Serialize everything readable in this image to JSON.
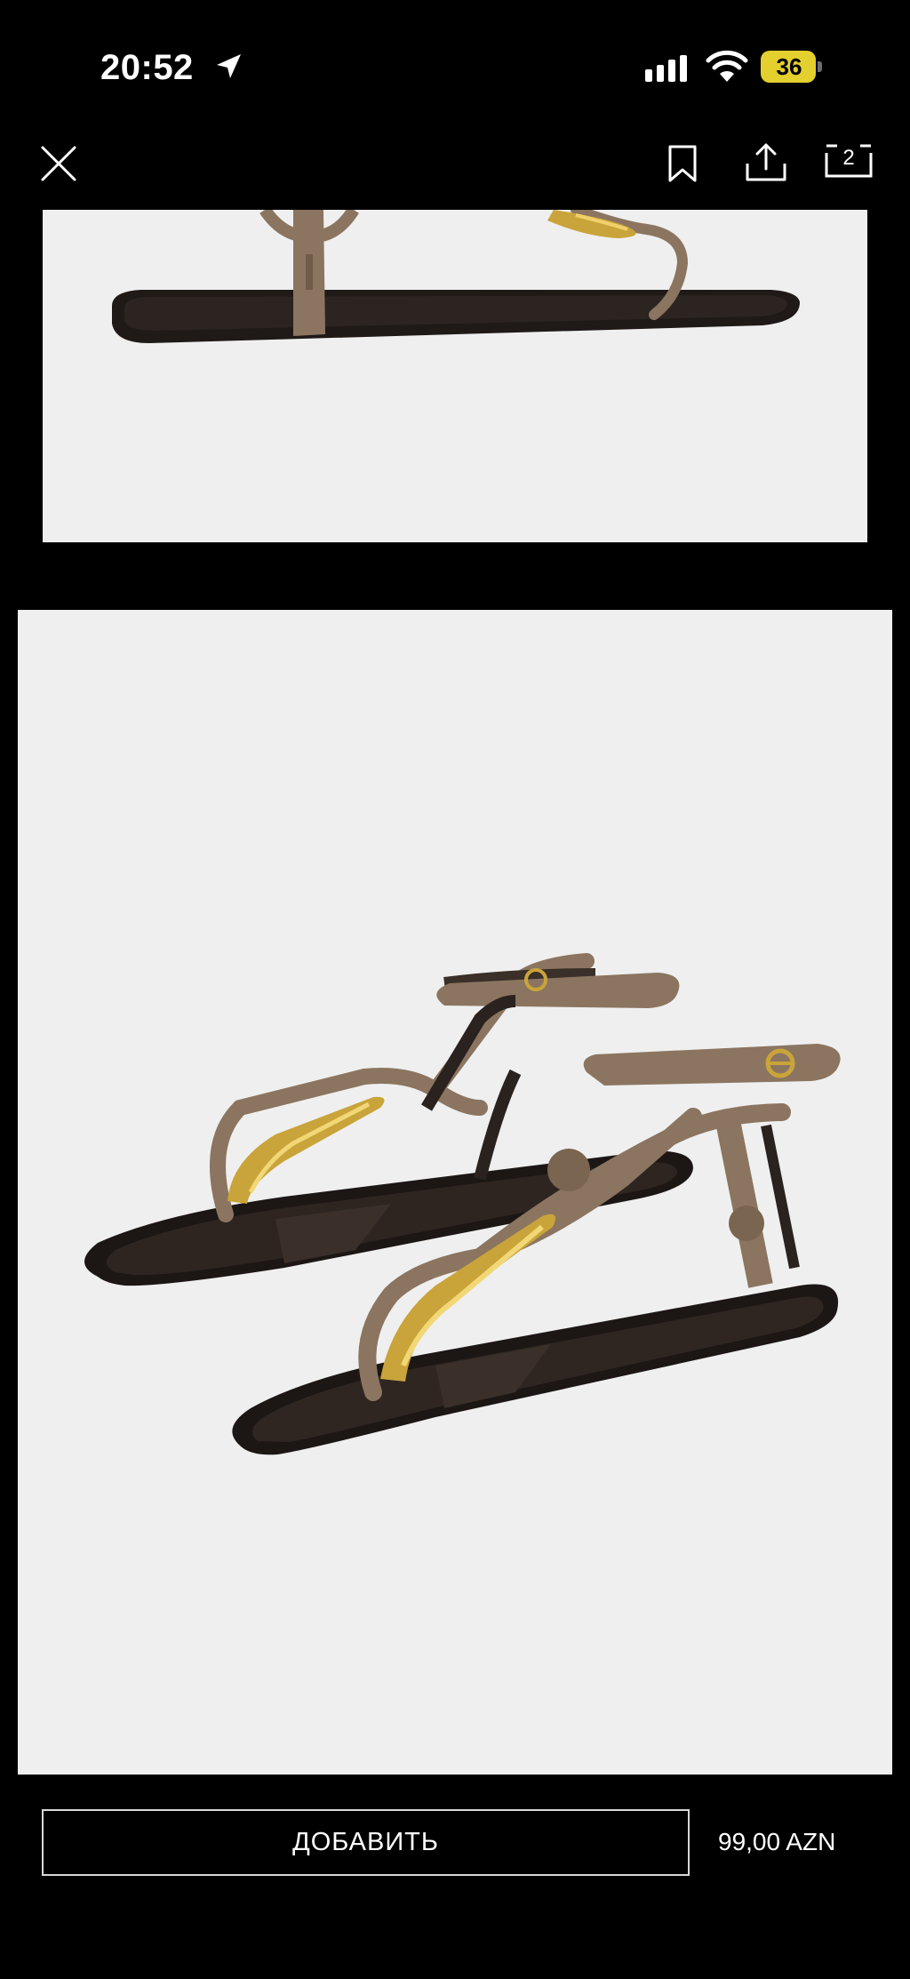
{
  "status_bar": {
    "time": "20:52",
    "battery_level": "36",
    "icons": [
      "location-arrow-icon",
      "cellular-signal-icon",
      "wifi-icon",
      "battery-icon"
    ]
  },
  "top_nav": {
    "icons": [
      "close-icon",
      "bookmark-icon",
      "share-icon",
      "tabs-icon"
    ],
    "tabs_count": "2"
  },
  "product": {
    "images": [
      {
        "subject": "sandal-side-view"
      },
      {
        "subject": "sandals-pair-view"
      }
    ],
    "add_button_label": "ДОБАВИТЬ",
    "price": "99,00 AZN"
  },
  "colors": {
    "background": "#000000",
    "image_background": "#efefef",
    "battery": "#e3cf2d",
    "strap": "#8b7560",
    "sole": "#2a221e",
    "buckle_gold": "#c9a43a"
  }
}
